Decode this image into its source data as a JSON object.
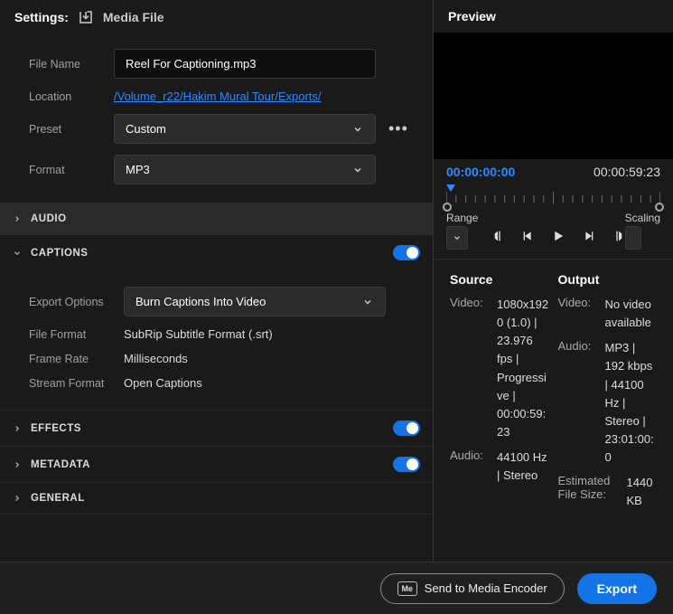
{
  "header": {
    "settings_label": "Settings:",
    "media_file_label": "Media File"
  },
  "form": {
    "fileName": {
      "label": "File Name",
      "value": "Reel For Captioning.mp3"
    },
    "location": {
      "label": "Location",
      "value": "/Volume_r22/Hakim Mural Tour/Exports/"
    },
    "preset": {
      "label": "Preset",
      "value": "Custom"
    },
    "format": {
      "label": "Format",
      "value": "MP3"
    }
  },
  "sections": {
    "audio": {
      "title": "AUDIO"
    },
    "captions": {
      "title": "CAPTIONS",
      "exportOptions": {
        "label": "Export Options",
        "value": "Burn Captions Into Video"
      },
      "fileFormat": {
        "label": "File Format",
        "value": "SubRip Subtitle Format (.srt)"
      },
      "frameRate": {
        "label": "Frame Rate",
        "value": "Milliseconds"
      },
      "streamFormat": {
        "label": "Stream Format",
        "value": "Open Captions"
      }
    },
    "effects": {
      "title": "EFFECTS"
    },
    "metadata": {
      "title": "METADATA"
    },
    "general": {
      "title": "GENERAL"
    }
  },
  "preview": {
    "title": "Preview",
    "time_current": "00:00:00:00",
    "time_total": "00:00:59:23",
    "range_label": "Range",
    "scaling_label": "Scaling"
  },
  "source": {
    "heading": "Source",
    "video_label": "Video:",
    "video_value": "1080x1920 (1.0) | 23.976 fps | Progressive | 00:00:59:23",
    "audio_label": "Audio:",
    "audio_value": "44100 Hz | Stereo"
  },
  "output": {
    "heading": "Output",
    "video_label": "Video:",
    "video_value": "No video available",
    "audio_label": "Audio:",
    "audio_value": "MP3 | 192 kbps | 44100 Hz | Stereo | 23:01:00:0",
    "est_label": "Estimated File Size:",
    "est_value": "1440 KB"
  },
  "footer": {
    "send_label": "Send to Media Encoder",
    "export_label": "Export",
    "me_badge": "Me"
  }
}
